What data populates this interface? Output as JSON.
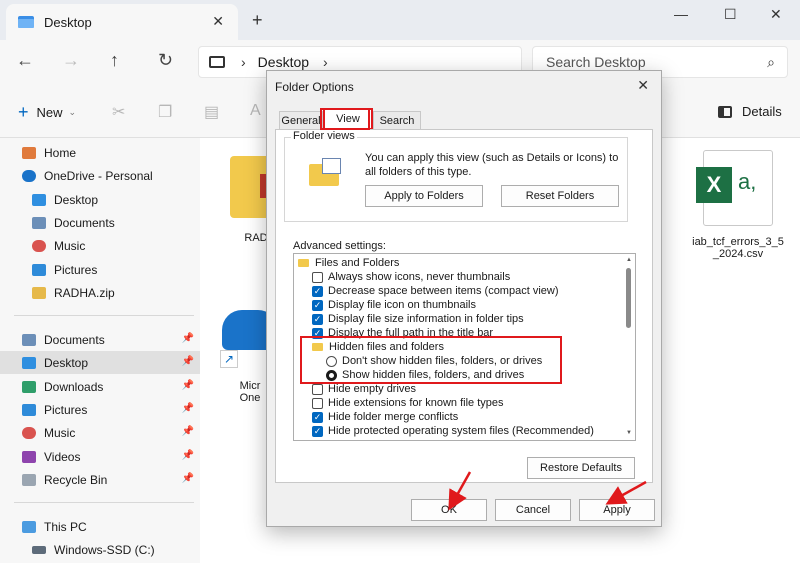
{
  "explorer": {
    "tab_title": "Desktop",
    "breadcrumb": "Desktop",
    "search_placeholder": "Search Desktop",
    "new_label": "New",
    "details_label": "Details"
  },
  "sidebar": {
    "items": [
      {
        "label": "Home"
      },
      {
        "label": "OneDrive - Personal"
      },
      {
        "label": "Desktop"
      },
      {
        "label": "Documents"
      },
      {
        "label": "Music"
      },
      {
        "label": "Pictures"
      },
      {
        "label": "RADHA.zip"
      },
      {
        "label": "Documents"
      },
      {
        "label": "Desktop"
      },
      {
        "label": "Downloads"
      },
      {
        "label": "Pictures"
      },
      {
        "label": "Music"
      },
      {
        "label": "Videos"
      },
      {
        "label": "Recycle Bin"
      },
      {
        "label": "This PC"
      },
      {
        "label": "Windows-SSD (C:)"
      }
    ]
  },
  "files": [
    {
      "name_line1": "RAD",
      "name_line2": ""
    },
    {
      "name_line1": "Micr",
      "name_line2": "One"
    },
    {
      "name_line1": "iab_tcf_errors_3_5",
      "name_line2": "_2024.csv"
    }
  ],
  "dialog": {
    "title": "Folder Options",
    "tabs": [
      "General",
      "View",
      "Search"
    ],
    "active_tab": "View",
    "folder_views": {
      "label": "Folder views",
      "description": "You can apply this view (such as Details or Icons) to all folders of this type.",
      "apply_button": "Apply to Folders",
      "reset_button": "Reset Folders"
    },
    "advanced_label": "Advanced settings:",
    "settings": [
      {
        "type": "folder",
        "label": "Files and Folders"
      },
      {
        "type": "checkbox",
        "checked": false,
        "label": "Always show icons, never thumbnails"
      },
      {
        "type": "checkbox",
        "checked": true,
        "label": "Decrease space between items (compact view)"
      },
      {
        "type": "checkbox",
        "checked": true,
        "label": "Display file icon on thumbnails"
      },
      {
        "type": "checkbox",
        "checked": true,
        "label": "Display file size information in folder tips"
      },
      {
        "type": "checkbox",
        "checked": true,
        "label": "Display the full path in the title bar"
      },
      {
        "type": "folder",
        "label": "Hidden files and folders"
      },
      {
        "type": "radio",
        "checked": false,
        "label": "Don't show hidden files, folders, or drives"
      },
      {
        "type": "radio",
        "checked": true,
        "label": "Show hidden files, folders, and drives"
      },
      {
        "type": "checkbox",
        "checked": false,
        "label": "Hide empty drives"
      },
      {
        "type": "checkbox",
        "checked": false,
        "label": "Hide extensions for known file types"
      },
      {
        "type": "checkbox",
        "checked": true,
        "label": "Hide folder merge conflicts"
      },
      {
        "type": "checkbox",
        "checked": true,
        "label": "Hide protected operating system files (Recommended)"
      }
    ],
    "restore_button": "Restore Defaults",
    "ok_button": "OK",
    "cancel_button": "Cancel",
    "apply_button": "Apply"
  },
  "colors": {
    "annotation_red": "#e0191c",
    "accent_blue": "#0067c0",
    "folder_yellow": "#f2c94c"
  }
}
